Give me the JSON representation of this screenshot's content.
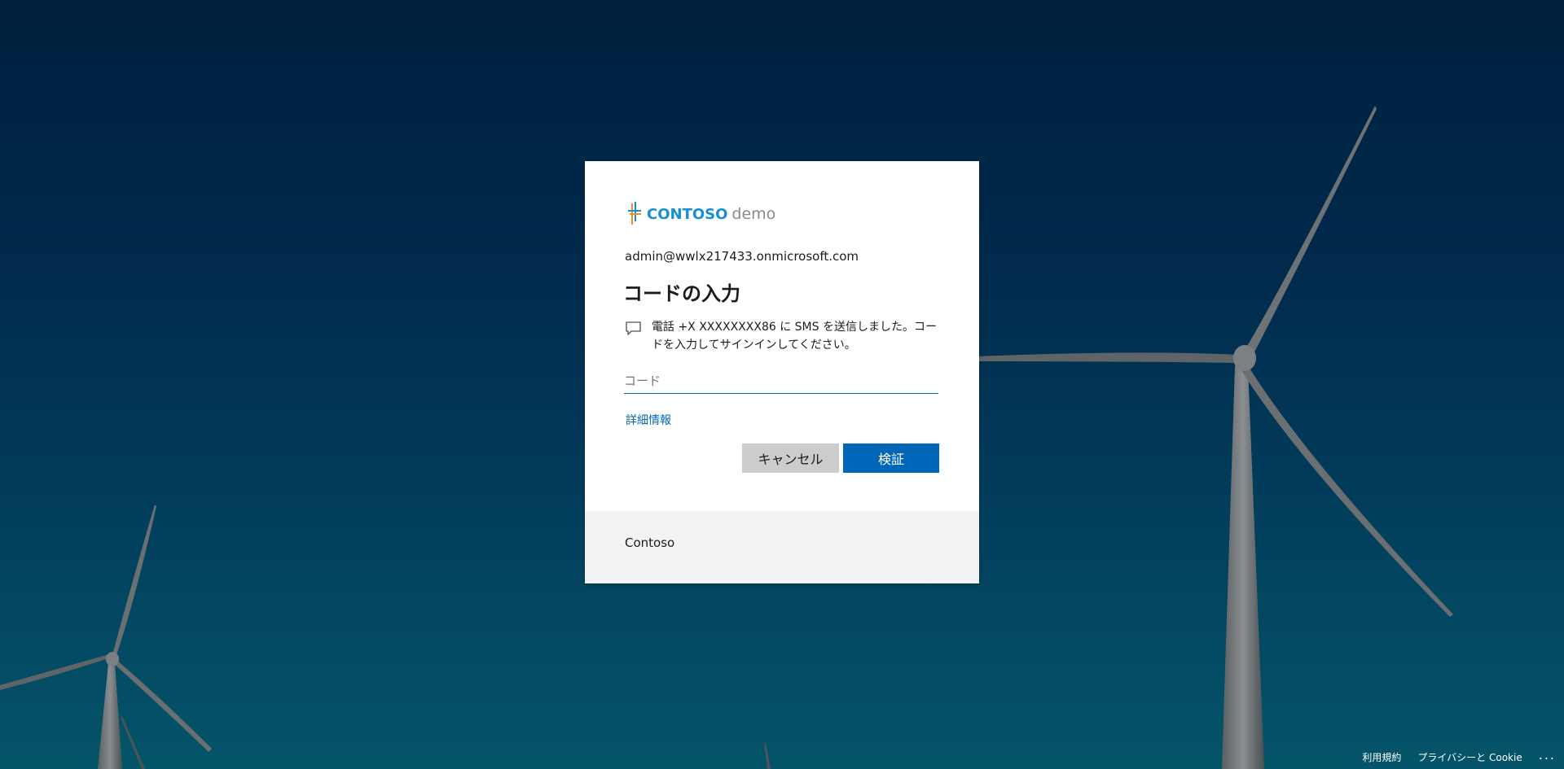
{
  "brand": {
    "name": "CONTOSO",
    "suffix": "demo",
    "colors": {
      "primary": "#1591cf",
      "accent_orange": "#f08a24"
    }
  },
  "identity": {
    "email": "admin@wwlx217433.onmicrosoft.com"
  },
  "verify": {
    "title": "コードの入力",
    "message_icon": "chat-bubble-icon",
    "message": "電話 +X XXXXXXXX86 に SMS を送信しました。コードを入力してサインインしてください。",
    "code_placeholder": "コード",
    "code_value": "",
    "more_info_link": "詳細情報",
    "cancel_label": "キャンセル",
    "verify_label": "検証"
  },
  "card_footer": {
    "text": "Contoso"
  },
  "page_footer": {
    "terms": "利用規約",
    "privacy": "プライバシーと Cookie",
    "more": "..."
  },
  "colors": {
    "button_primary": "#0067b8",
    "button_secondary": "#cccccc",
    "footer_bg": "#f2f2f2"
  }
}
